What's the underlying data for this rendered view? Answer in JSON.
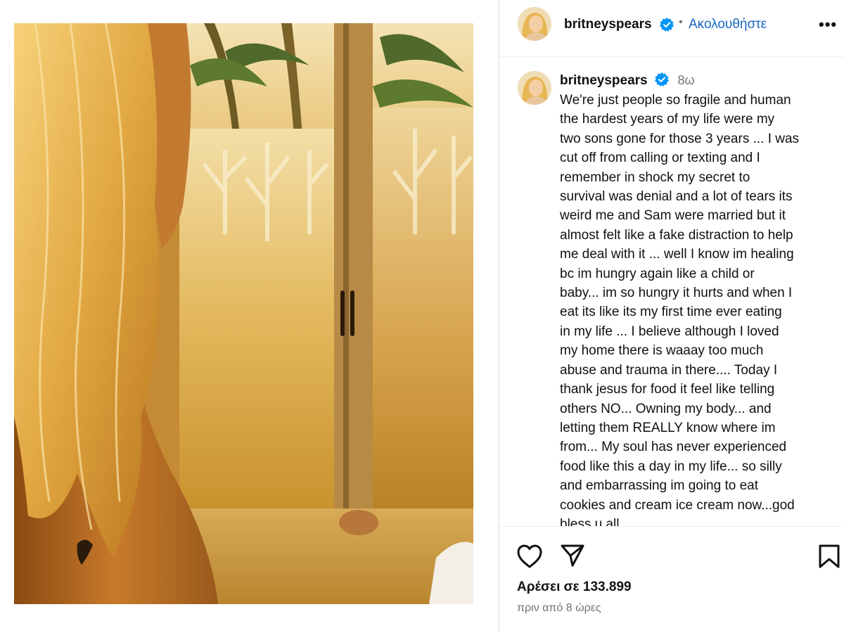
{
  "post": {
    "username": "britneyspears",
    "follow_label": "Ακολουθήστε",
    "separator": "•",
    "more_label": "•••",
    "caption_time": "8ω",
    "caption": "We're just people so fragile and human\nthe hardest years of my life were my\ntwo sons gone for those 3 years ... I was\ncut off from calling or texting and I\nremember in shock my secret to\nsurvival was denial and a lot of tears its\nweird me and Sam were married but it\nalmost felt like a fake distraction to help\nme deal with it ... well I know im healing\nbc im hungry again like a child or\nbaby... im so hungry it hurts and when I\neat its like its my first time ever eating\nin my life ... I believe although I loved\nmy home there is waaay too much\nabuse and trauma in there.... Today I\nthank jesus for food it feel like telling\nothers NO... Owning my  body... and\nletting them REALLY know where im\nfrom... My soul has never experienced\nfood like this a day in my life... so silly\nand embarrassing im going to eat\ncookies and cream ice cream now...god\nbless u all",
    "likes_label": "Αρέσει σε 133.899",
    "time_ago": "πριν από 8 ώρες"
  },
  "icons": {
    "verified": "verified-badge-icon",
    "like": "heart-icon",
    "share": "paper-plane-icon",
    "save": "bookmark-icon",
    "more": "more-options-icon"
  },
  "colors": {
    "link_blue": "#1a66c2",
    "verified_blue": "#0095f6",
    "secondary_text": "#737373",
    "divider": "#dbdbdb"
  }
}
